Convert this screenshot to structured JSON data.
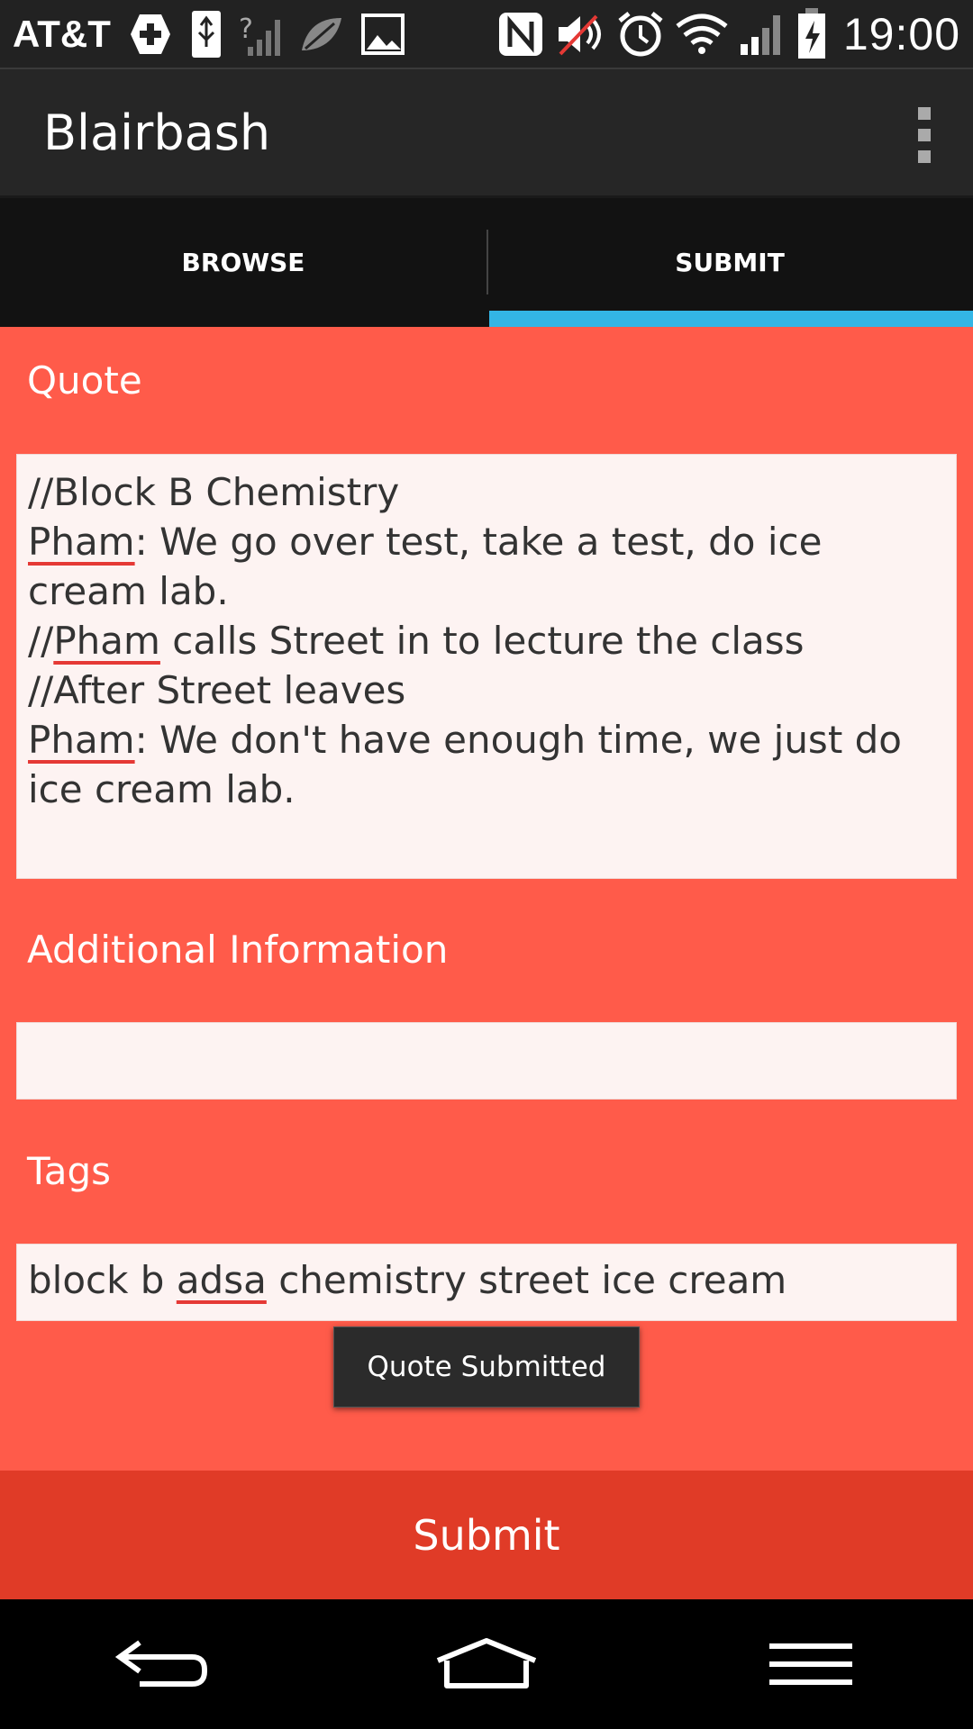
{
  "status_bar": {
    "carrier": "AT&T",
    "time": "19:00",
    "icons": [
      "medical-plus-icon",
      "usb-icon",
      "no-data-signal-icon",
      "leaf-icon",
      "image-icon",
      "nfc-icon",
      "mute-icon",
      "alarm-icon",
      "wifi-icon",
      "signal-icon",
      "battery-charging-icon"
    ]
  },
  "action_bar": {
    "title": "Blairbash",
    "overflow_icon": "overflow-menu-icon"
  },
  "tabs": [
    {
      "label": "BROWSE",
      "selected": false
    },
    {
      "label": "SUBMIT",
      "selected": true
    }
  ],
  "accent_color": "#33b5e5",
  "background_color": "#ff5b4a",
  "form": {
    "quote_label": "Quote",
    "quote_lines": [
      {
        "pre": "//Block B Chemistry",
        "mis": "",
        "post": ""
      },
      {
        "pre": "",
        "mis": "Pham",
        "post": ": We go over test, take a test, do ice cream lab."
      },
      {
        "pre": "//",
        "mis": "Pham",
        "post": " calls Street in to lecture the class"
      },
      {
        "pre": "//After Street leaves",
        "mis": "",
        "post": ""
      },
      {
        "pre": "",
        "mis": "Pham",
        "post": ": We don't have enough time, we just do ice cream lab."
      }
    ],
    "additional_label": "Additional Information",
    "additional_value": "",
    "tags_label": "Tags",
    "tags_pre": "block b ",
    "tags_mis": "adsa",
    "tags_post": " chemistry street ice cream"
  },
  "toast": "Quote Submitted",
  "submit_label": "Submit",
  "nav_bar": [
    "back-icon",
    "home-icon",
    "menu-icon"
  ]
}
